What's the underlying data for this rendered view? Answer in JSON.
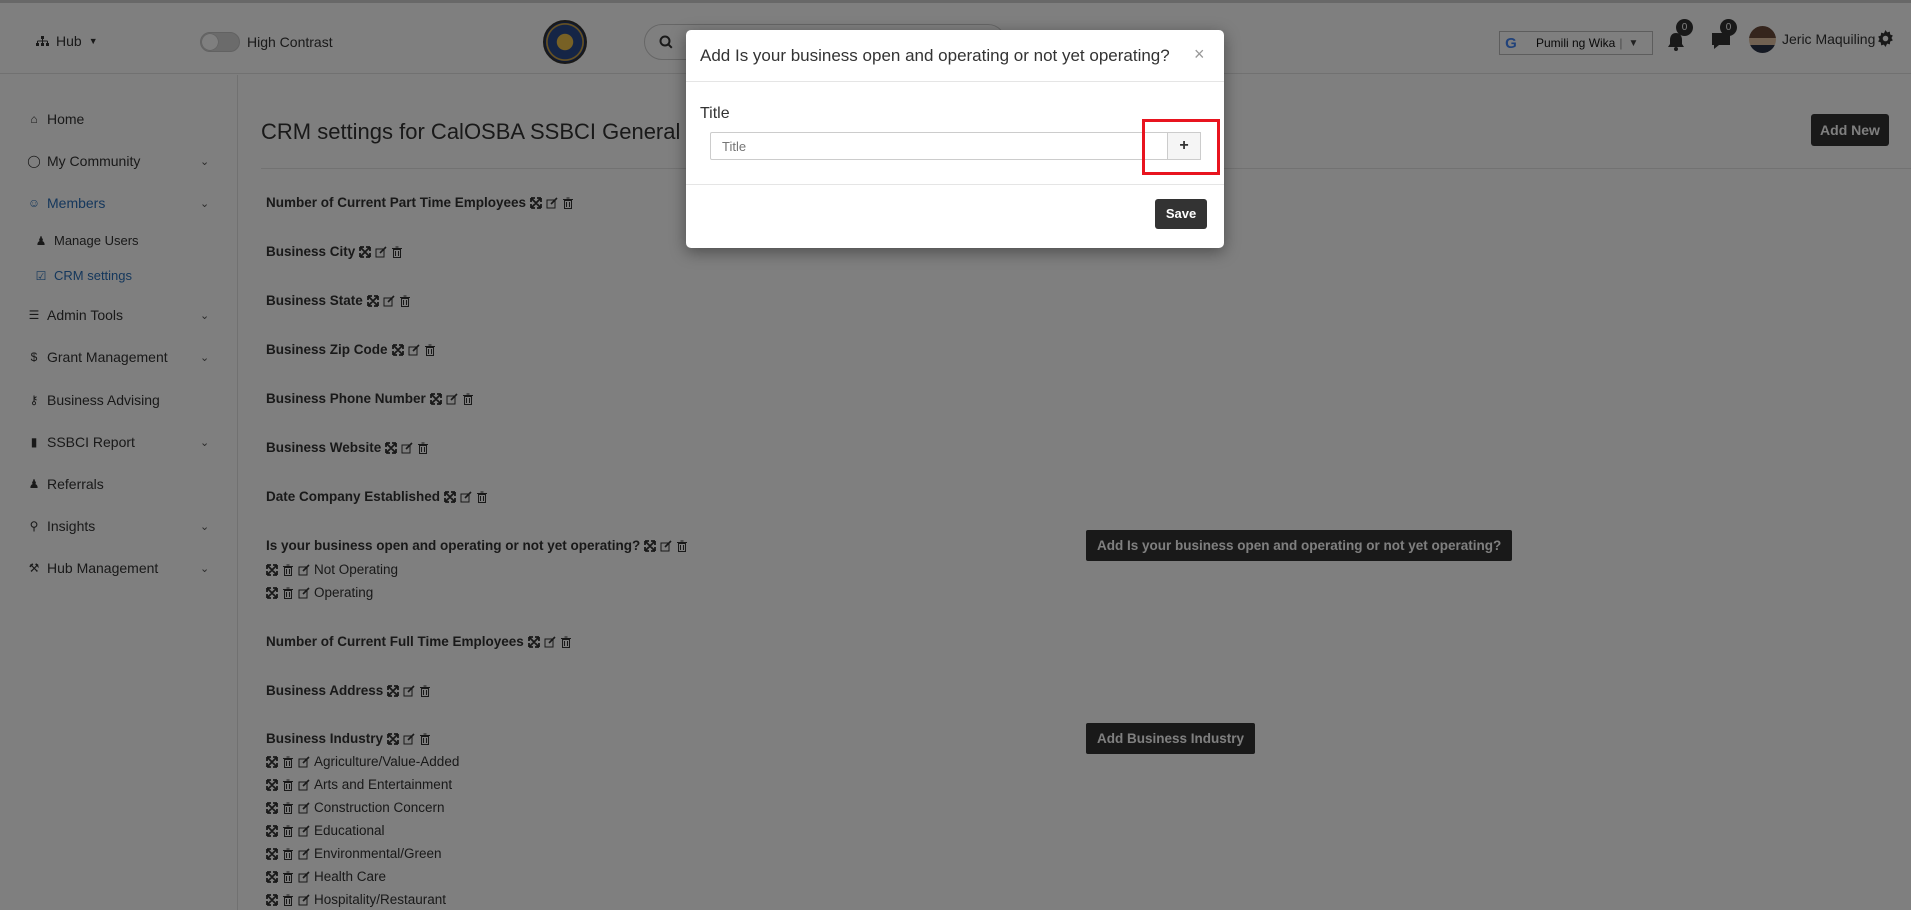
{
  "header": {
    "hub_label": "Hub",
    "high_contrast_label": "High Contrast",
    "search_placeholder": "",
    "translate": {
      "label": "Pumili ng Wika"
    },
    "notifications_count": "0",
    "messages_count": "0",
    "user_name": "Jeric Maquiling"
  },
  "sidebar": {
    "items": [
      {
        "label": "Home",
        "icon": "home-icon"
      },
      {
        "label": "My Community",
        "icon": "community-icon"
      },
      {
        "label": "Members",
        "icon": "user-circle-icon"
      },
      {
        "label": "Manage Users",
        "icon": "users-icon"
      },
      {
        "label": "CRM settings",
        "icon": "check-square-icon"
      },
      {
        "label": "Admin Tools",
        "icon": "list-icon"
      },
      {
        "label": "Grant Management",
        "icon": "dollar-icon"
      },
      {
        "label": "Business Advising",
        "icon": "key-icon"
      },
      {
        "label": "SSBCI Report",
        "icon": "file-icon"
      },
      {
        "label": "Referrals",
        "icon": "user-plus-icon"
      },
      {
        "label": "Insights",
        "icon": "lightbulb-icon"
      },
      {
        "label": "Hub Management",
        "icon": "wrench-icon"
      }
    ]
  },
  "main": {
    "title": "CRM settings for CalOSBA SSBCI General S",
    "add_new_label": "Add New",
    "fields": [
      "Number of Current Part Time Employees",
      "Business City",
      "Business State",
      "Business Zip Code",
      "Business Phone Number",
      "Business Website",
      "Date Company Established",
      "Is your business open and operating or not yet operating?",
      "Number of Current Full Time Employees",
      "Business Address",
      "Business Industry"
    ],
    "operating_options": [
      "Not Operating",
      "Operating"
    ],
    "industry_options": [
      "Agriculture/Value-Added",
      "Arts and Entertainment",
      "Construction Concern",
      "Educational",
      "Environmental/Green",
      "Health Care",
      "Hospitality/Restaurant"
    ],
    "add_operating_label": "Add Is your business open and operating or not yet operating?",
    "add_industry_label": "Add Business Industry"
  },
  "modal": {
    "title": "Add Is your business open and operating or not yet operating?",
    "close": "×",
    "field_label": "Title",
    "input_placeholder": "Title",
    "add_button": "+",
    "save_label": "Save"
  },
  "colors": {
    "dark_button": "#333333",
    "active_link": "#2a6fb8",
    "highlight": "#e8141f"
  }
}
